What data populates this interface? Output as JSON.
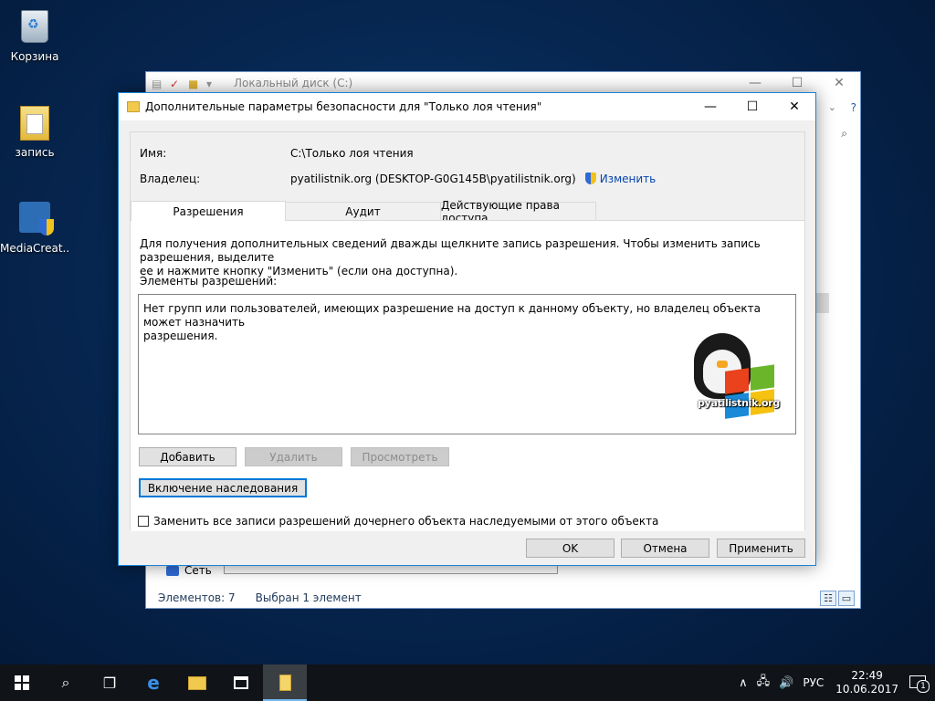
{
  "desktop": {
    "icons": [
      {
        "label": "Корзина",
        "icon": "recycle-bin-icon"
      },
      {
        "label": "запись",
        "icon": "folder-icon"
      },
      {
        "label": "MediaCreat...",
        "icon": "media-creation-tool-icon"
      }
    ]
  },
  "explorer": {
    "title": "Локальный диск (C:)",
    "nav_network": "Сеть",
    "status_items": "Элементов: 7",
    "status_selected": "Выбран 1 элемент"
  },
  "dialog": {
    "title": "Дополнительные параметры безопасности  для \"Только лоя чтения\"",
    "name_label": "Имя:",
    "name_value": "C:\\Только лоя чтения",
    "owner_label": "Владелец:",
    "owner_value": "pyatilistnik.org (DESKTOP-G0G145B\\pyatilistnik.org)",
    "owner_change_link": "Изменить",
    "tabs": [
      {
        "label": "Разрешения",
        "active": true
      },
      {
        "label": "Аудит",
        "active": false
      },
      {
        "label": "Действующие права доступа",
        "active": false
      }
    ],
    "hint_line1": "Для получения дополнительных сведений дважды щелкните запись разрешения. Чтобы изменить запись разрешения, выделите",
    "hint_line2": "ее и нажмите кнопку \"Изменить\" (если она доступна).",
    "permissions_label": "Элементы разрешений:",
    "permissions_message_line1": "Нет групп или пользователей, имеющих разрешение на доступ к данному объекту, но владелец объекта может назначить",
    "permissions_message_line2": "разрешения.",
    "watermark_text": "pyatilistnik.org",
    "buttons": {
      "add": "Добавить",
      "remove": "Удалить",
      "view": "Просмотреть",
      "enable_inheritance": "Включение наследования",
      "ok": "OK",
      "cancel": "Отмена",
      "apply": "Применить"
    },
    "replace_checkbox_label": "Заменить все записи разрешений дочернего объекта наследуемыми от этого объекта",
    "replace_checkbox_checked": false
  },
  "taskbar": {
    "language": "РУС",
    "time": "22:49",
    "date": "10.06.2017",
    "notification_count": "1"
  },
  "colors": {
    "accent": "#0078d7",
    "link": "#0645ad",
    "taskbar": "#101418"
  }
}
